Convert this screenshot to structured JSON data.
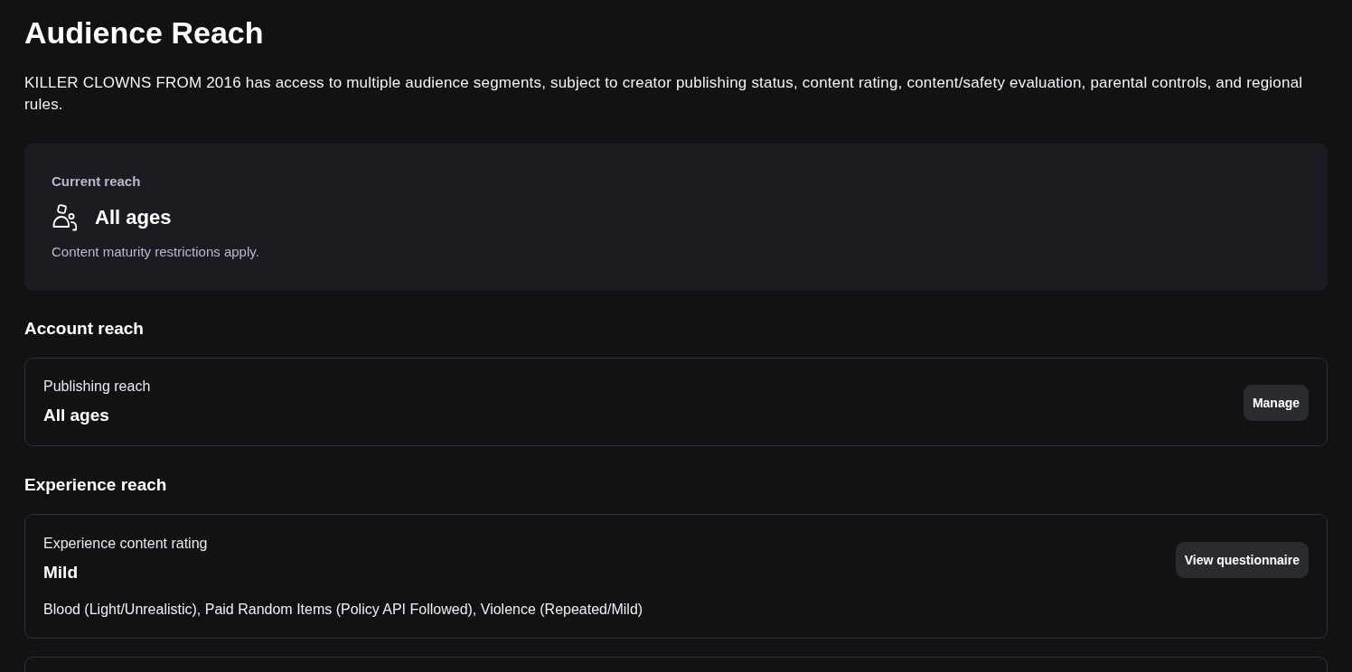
{
  "page": {
    "title": "Audience Reach",
    "description": "KILLER CLOWNS FROM 2016 has access to multiple audience segments, subject to creator publishing status, content rating, content/safety evaluation, parental controls, and regional rules."
  },
  "current_reach": {
    "label": "Current reach",
    "value": "All ages",
    "note": "Content maturity restrictions apply."
  },
  "sections": [
    {
      "title": "Account reach",
      "cards": [
        {
          "kind": "setting",
          "label": "Publishing reach",
          "value": "All ages",
          "button": "Manage"
        }
      ]
    },
    {
      "title": "Experience reach",
      "cards": [
        {
          "kind": "setting",
          "label": "Experience content rating",
          "value": "Mild",
          "details": "Blood (Light/Unrealistic), Paid Random Items (Policy API Followed), Violence (Repeated/Mild)",
          "button": "View questionnaire"
        },
        {
          "kind": "cut_off"
        }
      ]
    }
  ]
}
